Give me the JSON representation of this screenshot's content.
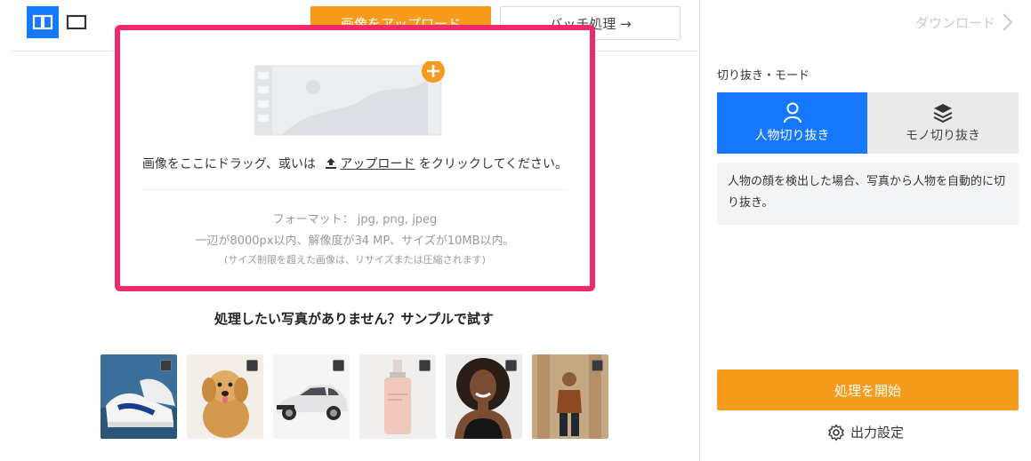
{
  "toolbar": {
    "upload_label": "画像をアップロード",
    "batch_label": "バッチ処理 →"
  },
  "drop_zone": {
    "hint_prefix": "画像をここにドラッグ、或いは",
    "hint_link": "アップロード",
    "hint_suffix": "をクリックしてください。",
    "format_line": "フォーマット： jpg, png, jpeg",
    "limit_line": "一辺が8000px以内、解像度が34 MP、サイズが10MB以内。",
    "resize_note": "(サイズ制限を超えた画像は、リサイズまたは圧縮されます)"
  },
  "samples": {
    "title": "処理したい写真がありません？サンプルで試す",
    "items": [
      "sneakers",
      "puppy",
      "car",
      "cosmetic-bottle",
      "woman",
      "man"
    ]
  },
  "panel": {
    "download_label": "ダウンロード",
    "mode_label": "切り抜き・モード",
    "modes": [
      {
        "label": "人物切り抜き",
        "icon": "person-icon",
        "active": true
      },
      {
        "label": "モノ切り抜き",
        "icon": "layers-icon",
        "active": false
      }
    ],
    "description": "人物の顔を検出した場合、写真から人物を自動的に切り抜き。",
    "start_label": "処理を開始",
    "output_settings_label": "出力設定"
  },
  "colors": {
    "accent_blue": "#1677ff",
    "accent_orange": "#f79b1c",
    "highlight_pink": "#ee2a6b"
  }
}
